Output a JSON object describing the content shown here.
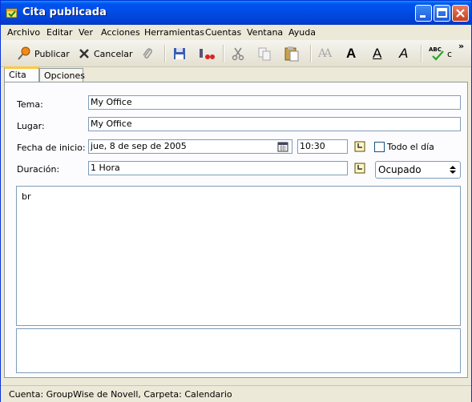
{
  "window": {
    "title": "Cita publicada"
  },
  "menu": [
    "Archivo",
    "Editar",
    "Ver",
    "Acciones",
    "Herramientas",
    "Cuentas",
    "Ventana",
    "Ayuda"
  ],
  "toolbar": {
    "publish_label": "Publicar",
    "cancel_label": "Cancelar",
    "overflow": "»",
    "font_glyph_outline": "AA",
    "font_glyph_bold": "A",
    "font_glyph_underline": "A",
    "font_glyph_italic": "A",
    "spell_cut_text": "ABC",
    "spell_trailing": "c"
  },
  "tabs": [
    {
      "label": "Cita",
      "active": true
    },
    {
      "label": "Opciones",
      "active": false
    }
  ],
  "form": {
    "subject_label": "Tema:",
    "subject_value": "My Office",
    "place_label": "Lugar:",
    "place_value": "My Office",
    "start_label": "Fecha de inicio:",
    "start_date": "jue, 8 de sep de 2005",
    "start_time": "10:30",
    "allday_label": "Todo el día",
    "allday_checked": false,
    "duration_label": "Duración:",
    "duration_value": "1 Hora",
    "show_as_value": "Ocupado"
  },
  "message_body": "br",
  "status": {
    "text": "Cuenta: GroupWise de Novell,  Carpeta: Calendario"
  },
  "colors": {
    "titlebar": "#0053ee",
    "tab_highlight": "#ffc83c",
    "field_border": "#7f9db9"
  }
}
